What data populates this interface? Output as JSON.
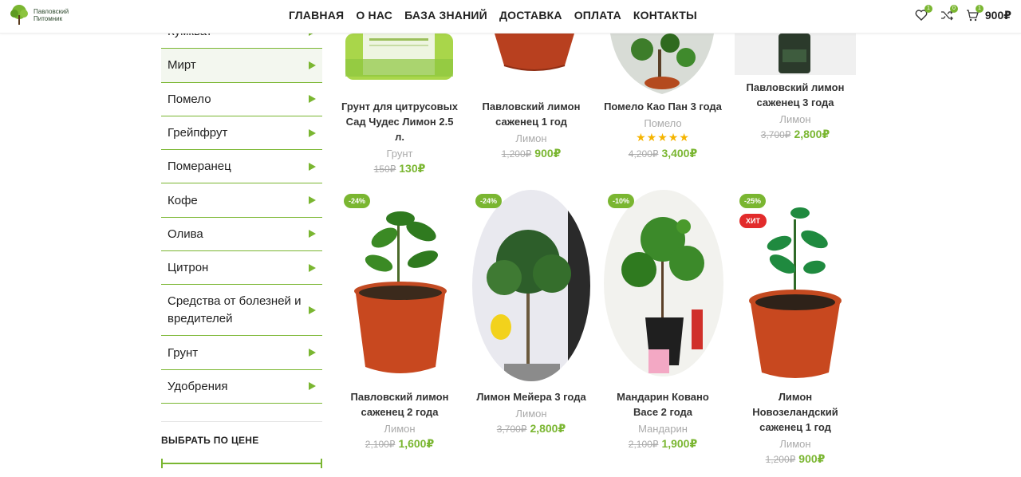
{
  "header": {
    "logo_line1": "Павловский",
    "logo_line2": "Питомник",
    "nav": [
      "ГЛАВНАЯ",
      "О НАС",
      "БАЗА ЗНАНИЙ",
      "ДОСТАВКА",
      "ОПЛАТА",
      "КОНТАКТЫ"
    ],
    "wishlist_count": "1",
    "compare_count": "0",
    "cart_count": "1",
    "cart_total": "900₽"
  },
  "sidebar": {
    "categories": [
      "Кумкват",
      "Мирт",
      "Помело",
      "Грейпфрут",
      "Померанец",
      "Кофе",
      "Олива",
      "Цитрон",
      "Средства от болезней и вредителей",
      "Грунт",
      "Удобрения"
    ],
    "price_filter_title": "ВЫБРАТЬ ПО ЦЕНЕ"
  },
  "products_top": [
    {
      "name": "Грунт для цитрусовых Сад Чудес Лимон 2.5 л.",
      "category": "Грунт",
      "old_price": "150₽",
      "price": "130₽"
    },
    {
      "name": "Павловский лимон саженец 1 год",
      "category": "Лимон",
      "old_price": "1,200₽",
      "price": "900₽"
    },
    {
      "name": "Помело Као Пан 3 года",
      "category": "Помело",
      "stars": "★★★★★",
      "old_price": "4,200₽",
      "price": "3,400₽"
    },
    {
      "name": "Павловский лимон саженец 3 года",
      "category": "Лимон",
      "old_price": "3,700₽",
      "price": "2,800₽"
    }
  ],
  "products_bottom": [
    {
      "name": "Павловский лимон саженец 2 года",
      "category": "Лимон",
      "old_price": "2,100₽",
      "price": "1,600₽",
      "sale": "-24%"
    },
    {
      "name": "Лимон Мейера 3 года",
      "category": "Лимон",
      "old_price": "3,700₽",
      "price": "2,800₽",
      "sale": "-24%"
    },
    {
      "name": "Мандарин Ковано Васе 2 года",
      "category": "Мандарин",
      "old_price": "2,100₽",
      "price": "1,900₽",
      "sale": "-10%"
    },
    {
      "name": "Лимон Новозеландский саженец 1 год",
      "category": "Лимон",
      "old_price": "1,200₽",
      "price": "900₽",
      "sale": "-25%",
      "hit": "ХИТ"
    }
  ],
  "colors": {
    "accent": "#7ab631",
    "hit": "#e22b2b",
    "stars": "#f5b400"
  }
}
